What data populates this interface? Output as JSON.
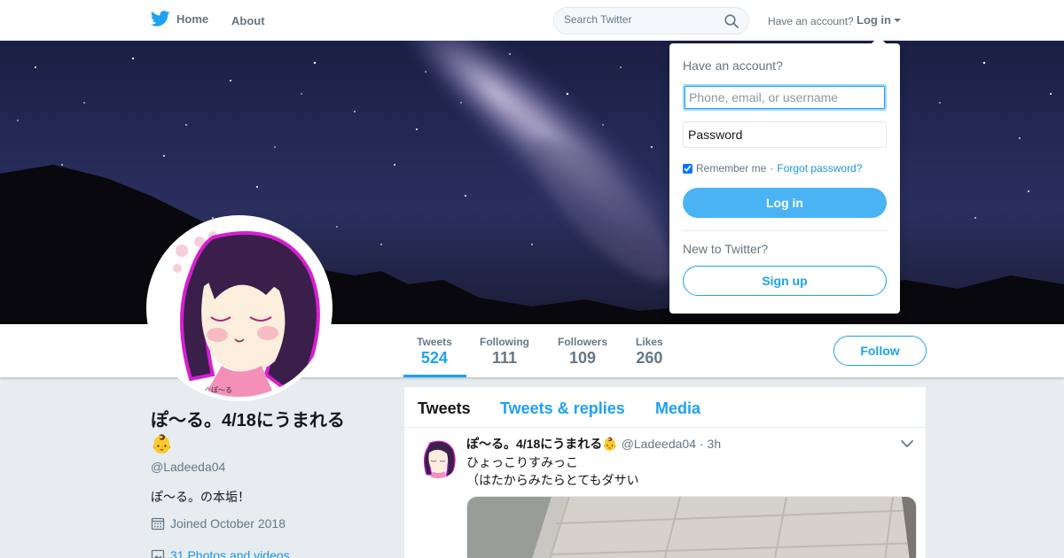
{
  "nav": {
    "home_label": "Home",
    "about_label": "About",
    "search_placeholder": "Search Twitter",
    "have_account": "Have an account?",
    "login_label": "Log in"
  },
  "profile": {
    "name": "ぽ〜る。4/18にうまれる",
    "name_emoji": "👶",
    "handle": "@Ladeeda04",
    "bio": "ぽ〜る。の本垢！",
    "joined": "Joined October 2018",
    "photos": "31 Photos and videos",
    "avatar_caption": "ぐぽ〜る"
  },
  "stats": [
    {
      "label": "Tweets",
      "value": "524"
    },
    {
      "label": "Following",
      "value": "111"
    },
    {
      "label": "Followers",
      "value": "109"
    },
    {
      "label": "Likes",
      "value": "260"
    }
  ],
  "follow_label": "Follow",
  "timeline": {
    "tabs": [
      "Tweets",
      "Tweets & replies",
      "Media"
    ],
    "tweet": {
      "name": "ぽ〜る。4/18にうまれる",
      "emoji": "👶",
      "handle": "@Ladeeda04",
      "time": "· 3h",
      "line1": "ひょっこりすみっこ",
      "line2": "（はたからみたらとてもダサい"
    }
  },
  "login_dropdown": {
    "title": "Have an account?",
    "username_placeholder": "Phone, email, or username",
    "password_placeholder": "Password",
    "remember_me": "Remember me",
    "separator": " · ",
    "forgot_password": "Forgot password?",
    "login_button": "Log in",
    "new_to_twitter": "New to Twitter?",
    "signup_button": "Sign up"
  },
  "colors": {
    "brand_blue": "#1da1f2",
    "login_button": "#4ab3f4",
    "background": "#e6ecf0"
  }
}
